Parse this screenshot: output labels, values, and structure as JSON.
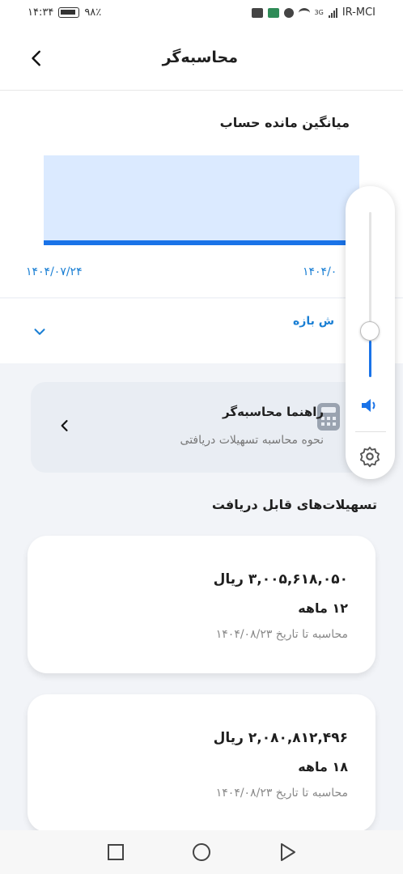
{
  "status_bar": {
    "time": "۱۴:۳۴",
    "battery": "۹۸٪",
    "network_type": "3G",
    "carrier": "IR-MCI"
  },
  "header": {
    "title": "محاسبه‌گر"
  },
  "chart_card": {
    "title": "میانگین مانده حساب",
    "chart_data": {
      "type": "area",
      "title": "میانگین مانده حساب",
      "xlabel": "",
      "ylabel": "",
      "x": [
        "۱۴۰۴/۰۷/۲۴",
        "۱۴۰۴/۰"
      ],
      "series": [
        {
          "values": [
            0,
            0
          ]
        }
      ],
      "grid": false,
      "colors": {
        "line": "#1a73e8",
        "fill": "#dbeaff"
      }
    },
    "date_left": "۱۴۰۴/۰۷/۲۴",
    "date_right": "۱۴۰۴/۰"
  },
  "range_selector": {
    "label": "ش بازه"
  },
  "guide_card": {
    "title": "راهنما محاسبه‌گر",
    "subtitle": "نحوه محاسبه تسهیلات دریافتی"
  },
  "section_title": "تسهیلات‌های قابل دریافت",
  "loans": [
    {
      "amount": "۳,۰۰۵,۶۱۸,۰۵۰ ریال",
      "term": "۱۲ ماهه",
      "date": "محاسبه تا تاریخ ۱۴۰۴/۰۸/۲۳"
    },
    {
      "amount": "۲,۰۸۰,۸۱۲,۴۹۶ ریال",
      "term": "۱۸ ماهه",
      "date": "محاسبه تا تاریخ ۱۴۰۴/۰۸/۲۳"
    }
  ],
  "volume_panel": {
    "level": 0.22,
    "accent": "#1a73e8"
  },
  "icons": {
    "back": "chevron-left-icon",
    "range": "chevron-down-icon",
    "guide_arrow": "chevron-left-icon",
    "calculator": "calculator-icon",
    "speaker": "speaker-icon",
    "settings": "gear-icon",
    "nav_recent": "square-icon",
    "nav_home": "circle-icon",
    "nav_back": "triangle-icon"
  }
}
